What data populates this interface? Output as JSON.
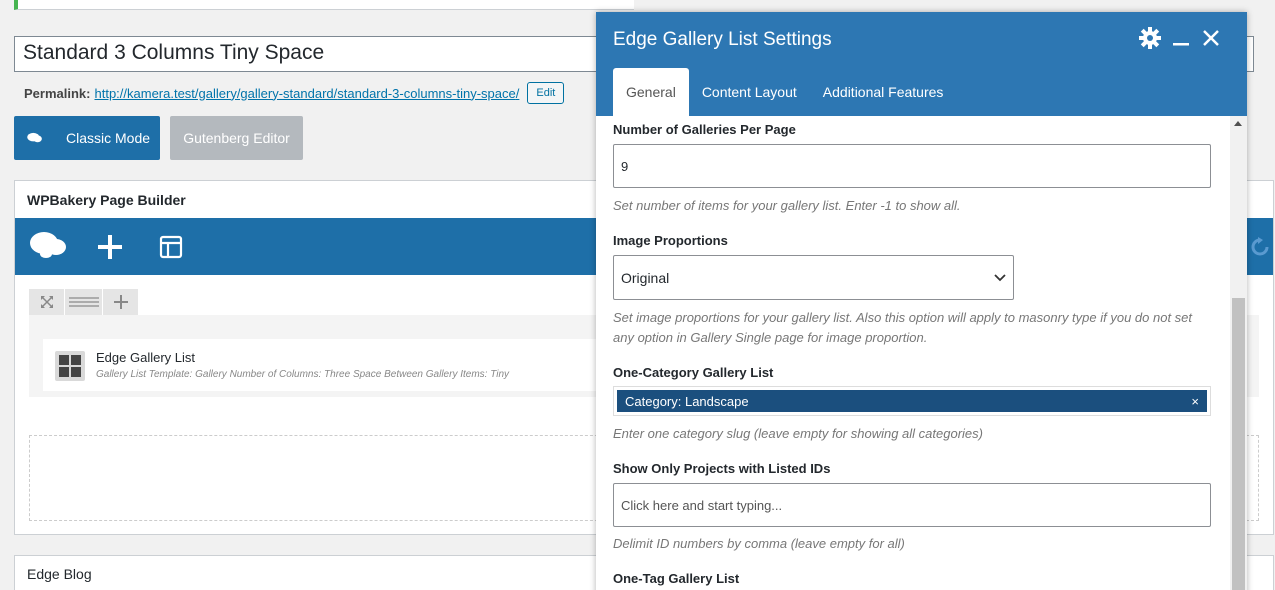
{
  "post": {
    "title": "Standard 3 Columns Tiny Space",
    "permalink_label": "Permalink:",
    "permalink_base": "http://kamera.test/gallery/gallery-standard/",
    "permalink_slug": "standard-3-columns-tiny-space",
    "permalink_trailing": "/",
    "edit_label": "Edit"
  },
  "modes": {
    "classic_label": "Classic Mode",
    "gutenberg_label": "Gutenberg Editor"
  },
  "page_builder": {
    "title": "WPBakery Page Builder",
    "element": {
      "title": "Edge Gallery List",
      "description": "Gallery List Template: Gallery  Number of Columns: Three  Space Between Gallery Items: Tiny"
    }
  },
  "blog": {
    "title": "Edge Blog"
  },
  "modal": {
    "title": "Edge Gallery List Settings",
    "tabs": [
      {
        "label": "General",
        "active": true
      },
      {
        "label": "Content Layout",
        "active": false
      },
      {
        "label": "Additional Features",
        "active": false
      }
    ],
    "fields": {
      "per_page": {
        "label": "Number of Galleries Per Page",
        "value": "9",
        "help": "Set number of items for your gallery list. Enter -1 to show all."
      },
      "proportions": {
        "label": "Image Proportions",
        "value": "Original",
        "help": "Set image proportions for your gallery list. Also this option will apply to masonry type if you do not set any option in Gallery Single page for image proportion."
      },
      "category": {
        "label": "One-Category Gallery List",
        "tag": "Category: Landscape",
        "remove": "×",
        "help": "Enter one category slug (leave empty for showing all categories)"
      },
      "ids": {
        "label": "Show Only Projects with Listed IDs",
        "placeholder": "Click here and start typing...",
        "help": "Delimit ID numbers by comma (leave empty for all)"
      },
      "tag": {
        "label": "One-Tag Gallery List"
      }
    }
  },
  "colors": {
    "primary": "#1e6fa8",
    "modal_header": "#2d77b3",
    "tag_chip": "#1b4f7e",
    "notice_green": "#46b450"
  }
}
